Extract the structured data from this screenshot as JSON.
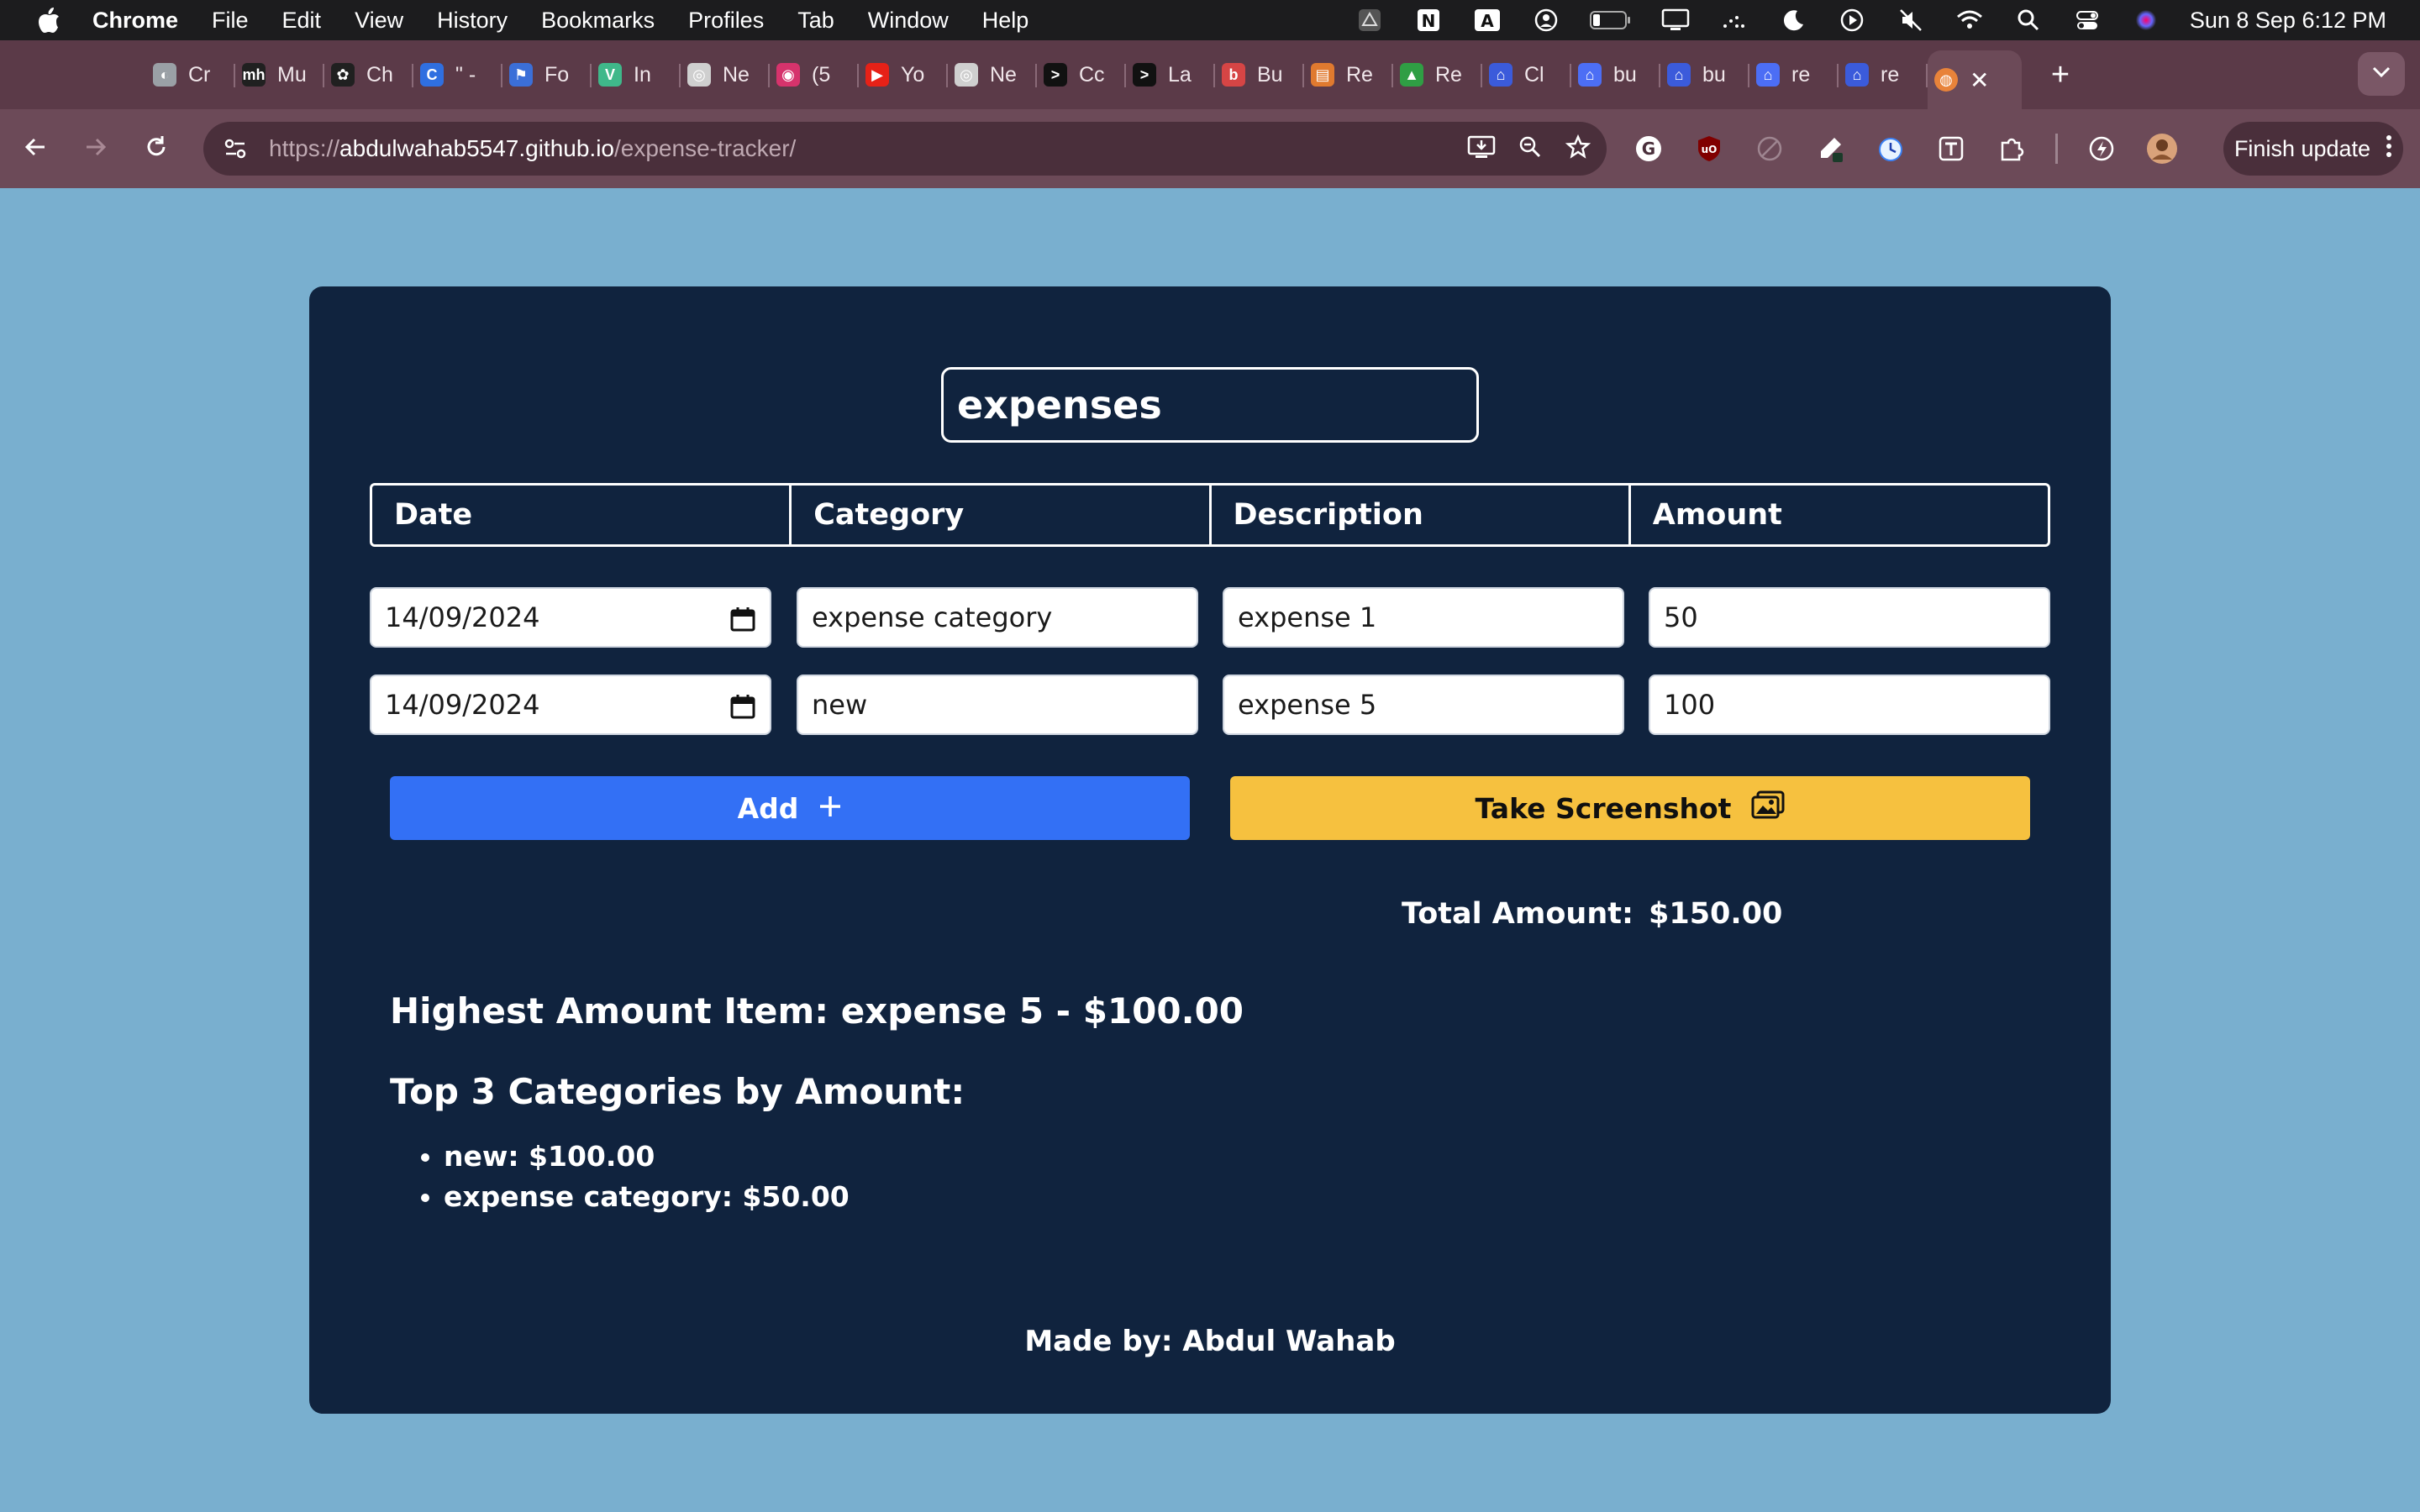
{
  "menubar": {
    "app_name": "Chrome",
    "items": [
      "File",
      "Edit",
      "View",
      "History",
      "Bookmarks",
      "Profiles",
      "Tab",
      "Window",
      "Help"
    ],
    "clock": "Sun 8 Sep  6:12 PM"
  },
  "tabs": [
    {
      "label": "Cr",
      "color": "#9aa0a6",
      "glyph": "◐"
    },
    {
      "label": "Mu",
      "color": "#202020",
      "glyph": "mh"
    },
    {
      "label": "Ch",
      "color": "#202020",
      "glyph": "✿"
    },
    {
      "label": "\" -",
      "color": "#2f6fe0",
      "glyph": "C"
    },
    {
      "label": "Fo",
      "color": "#3b6fd8",
      "glyph": "⚑"
    },
    {
      "label": "In",
      "color": "#3fb88a",
      "glyph": "V"
    },
    {
      "label": "Ne",
      "color": "#cfcfcf",
      "glyph": "◎"
    },
    {
      "label": "(5",
      "color": "#d6336c",
      "glyph": "◉"
    },
    {
      "label": "Yo",
      "color": "#e62117",
      "glyph": "▶"
    },
    {
      "label": "Ne",
      "color": "#cfcfcf",
      "glyph": "◎"
    },
    {
      "label": "Cc",
      "color": "#111111",
      "glyph": ">"
    },
    {
      "label": "La",
      "color": "#111111",
      "glyph": ">"
    },
    {
      "label": "Bu",
      "color": "#d64545",
      "glyph": "b"
    },
    {
      "label": "Re",
      "color": "#e07a2f",
      "glyph": "▤"
    },
    {
      "label": "Re",
      "color": "#2f9e44",
      "glyph": "▲"
    },
    {
      "label": "Cl",
      "color": "#3b5bdb",
      "glyph": "⌂"
    },
    {
      "label": "bu",
      "color": "#4c6ef5",
      "glyph": "⌂"
    },
    {
      "label": "bu",
      "color": "#3b5bdb",
      "glyph": "⌂"
    },
    {
      "label": "re",
      "color": "#4c6ef5",
      "glyph": "⌂"
    },
    {
      "label": "re",
      "color": "#3b5bdb",
      "glyph": "⌂"
    }
  ],
  "active_tab": {
    "color": "#e8833a",
    "glyph": "◍"
  },
  "omnibox": {
    "scheme": "https://",
    "host": "abdulwahab5547.github.io",
    "path": "/expense-tracker/"
  },
  "toolbar": {
    "finish_update_label": "Finish update"
  },
  "app": {
    "title_value": "expenses",
    "columns": [
      "Date",
      "Category",
      "Description",
      "Amount"
    ],
    "rows": [
      {
        "date": "14/09/2024",
        "category": "expense category",
        "description": "expense 1",
        "amount": "50"
      },
      {
        "date": "14/09/2024",
        "category": "new",
        "description": "expense 5",
        "amount": "100"
      }
    ],
    "add_label": "Add",
    "screenshot_label": "Take Screenshot",
    "total_label": "Total Amount:",
    "total_value": "$150.00",
    "highest_item": "Highest Amount Item: expense 5 - $100.00",
    "top3_heading": "Top 3 Categories by Amount:",
    "top3": [
      "new: $100.00",
      "expense category: $50.00"
    ],
    "footer": "Made by: Abdul Wahab"
  },
  "colors": {
    "page_bg": "#79afcf",
    "card_bg": "#10233e",
    "add_button": "#3370f5",
    "screenshot_button": "#f6c13f",
    "tabstrip": "#5b3a48",
    "toolbar": "#6c4a58"
  }
}
